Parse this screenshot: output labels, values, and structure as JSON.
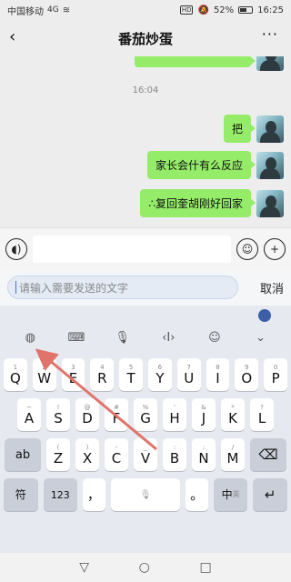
{
  "status_bar": {
    "carrier": "中国移动",
    "signal": "4G",
    "hd": "HD",
    "battery": "52%",
    "time": "16:25"
  },
  "header": {
    "title": "番茄炒蛋",
    "back_icon": "chevron-left-icon",
    "more_icon": "more-dots-icon",
    "more_glyph": "···"
  },
  "chat": {
    "timestamp": "16:04",
    "messages": [
      {
        "text": "把"
      },
      {
        "text": "家长会什有么反应"
      },
      {
        "text": "∴复回奎胡刚好回家"
      }
    ]
  },
  "input_bar": {
    "voice_icon": "voice-icon",
    "emoji_icon": "emoji-icon",
    "plus_icon": "plus-icon"
  },
  "send_row": {
    "placeholder": "请输入需要发送的文字",
    "cancel_label": "取消"
  },
  "keyboard": {
    "toolbar_icons": [
      "translate-icon",
      "keyboard-icon",
      "mic-icon",
      "cursor-move-icon",
      "emoji-icon",
      "collapse-icon"
    ],
    "row1": [
      {
        "main": "Q",
        "sub": "1"
      },
      {
        "main": "W",
        "sub": "2"
      },
      {
        "main": "E",
        "sub": "3"
      },
      {
        "main": "R",
        "sub": "4"
      },
      {
        "main": "T",
        "sub": "5"
      },
      {
        "main": "Y",
        "sub": "6"
      },
      {
        "main": "U",
        "sub": "7"
      },
      {
        "main": "I",
        "sub": "8"
      },
      {
        "main": "O",
        "sub": "9"
      },
      {
        "main": "P",
        "sub": "0"
      }
    ],
    "row2": [
      {
        "main": "A",
        "sub": "~"
      },
      {
        "main": "S",
        "sub": "!"
      },
      {
        "main": "D",
        "sub": "@"
      },
      {
        "main": "F",
        "sub": "#"
      },
      {
        "main": "G",
        "sub": "%"
      },
      {
        "main": "H",
        "sub": "'"
      },
      {
        "main": "J",
        "sub": "&"
      },
      {
        "main": "K",
        "sub": "*"
      },
      {
        "main": "L",
        "sub": "?"
      }
    ],
    "row3": [
      {
        "main": "Z",
        "sub": "("
      },
      {
        "main": "X",
        "sub": ")"
      },
      {
        "main": "C",
        "sub": "-"
      },
      {
        "main": "V",
        "sub": "_"
      },
      {
        "main": "B",
        "sub": ":"
      },
      {
        "main": "N",
        "sub": ";"
      },
      {
        "main": "M",
        "sub": "/"
      }
    ],
    "ab_label": "ab",
    "symbol_label": "符",
    "num_label": "123",
    "comma_label": "，",
    "period_label": "。",
    "lang_main": "中",
    "lang_sub": "英",
    "delete_glyph": "⌫",
    "enter_glyph": "↵"
  },
  "nav_bar": {
    "back": "▽",
    "home": "○",
    "recent": "□"
  },
  "colors": {
    "bubble": "#95ec69",
    "annotation_arrow": "#e0736a"
  }
}
